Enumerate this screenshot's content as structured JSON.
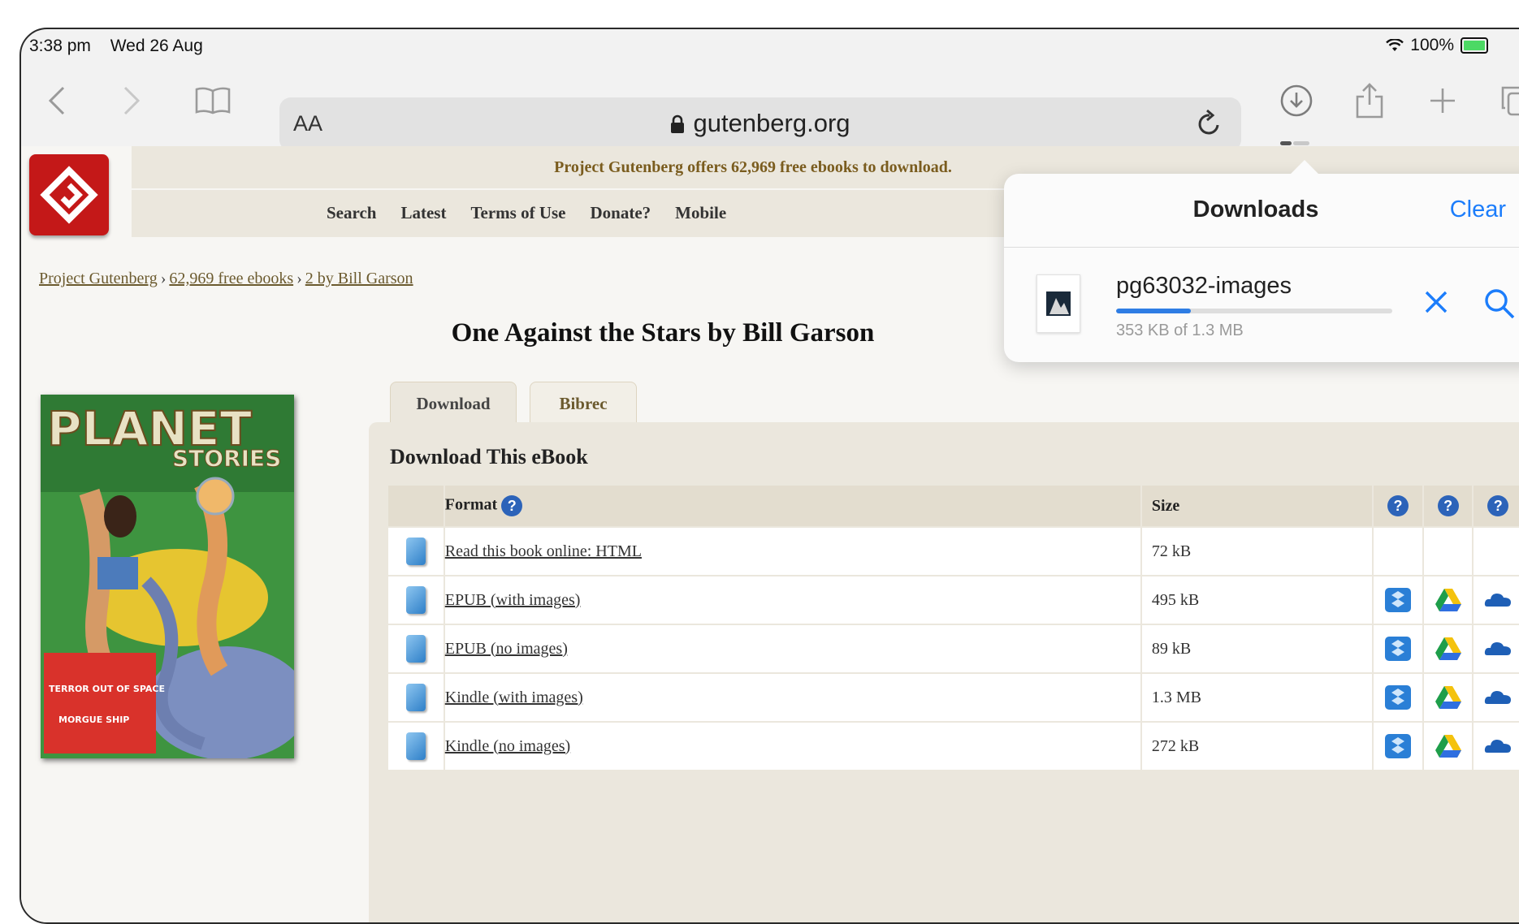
{
  "status": {
    "time": "3:38 pm",
    "date": "Wed 26 Aug",
    "battery": "100%"
  },
  "browser": {
    "reader_label": "AA",
    "url": "gutenberg.org",
    "accent": "#1c7dfb"
  },
  "site": {
    "offer": "Project Gutenberg offers 62,969 free ebooks to download.",
    "nav": [
      "Search",
      "Latest",
      "Terms of Use",
      "Donate?",
      "Mobile"
    ],
    "breadcrumb": [
      "Project Gutenberg",
      "62,969 free ebooks",
      "2 by Bill Garson"
    ],
    "breadcrumb_sep": "›",
    "title": "One Against the Stars by Bill Garson",
    "tabs": [
      "Download",
      "Bibrec"
    ],
    "panel_title": "Download This eBook",
    "table": {
      "headers": {
        "format": "Format",
        "size": "Size"
      },
      "rows": [
        {
          "format": "Read this book online: HTML",
          "size": "72 kB",
          "services": false
        },
        {
          "format": "EPUB (with images)",
          "size": "495 kB",
          "services": true
        },
        {
          "format": "EPUB (no images)",
          "size": "89 kB",
          "services": true
        },
        {
          "format": "Kindle (with images)",
          "size": "1.3 MB",
          "services": true
        },
        {
          "format": "Kindle (no images)",
          "size": "272 kB",
          "services": true
        }
      ]
    },
    "cover": {
      "masthead": "PLANET",
      "subhead": "STORIES",
      "blurb": "TERROR OUT OF SPACE",
      "blurb2": "MORGUE SHIP"
    }
  },
  "downloads_popover": {
    "title": "Downloads",
    "clear_label": "Clear",
    "item": {
      "name": "pg63032-images",
      "progress_text": "353 KB of 1.3 MB",
      "progress_fraction": 0.27
    }
  }
}
